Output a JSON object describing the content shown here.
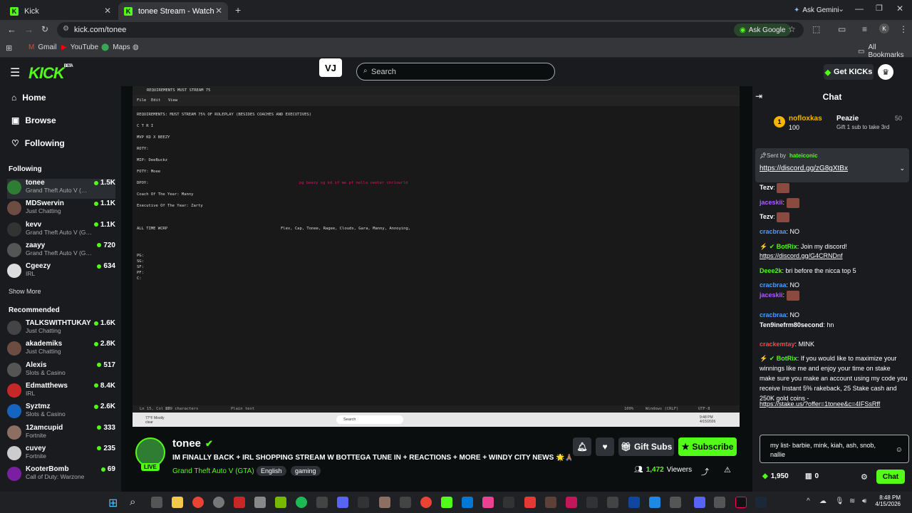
{
  "browser": {
    "tabs": [
      {
        "label": "Kick"
      },
      {
        "label": "tonee Stream - Watch Live on K"
      }
    ],
    "ask_gemini": "Ask Gemini",
    "url": "kick.com/tonee",
    "ask_google": "Ask Google",
    "bookmarks": [
      "Gmail",
      "YouTube",
      "Maps"
    ],
    "all_bookmarks": "All Bookmarks"
  },
  "header": {
    "logo": "KICK",
    "beta": "BETA",
    "search_placeholder": "Search",
    "get_kicks": "Get KICKs"
  },
  "sidebar": {
    "nav": [
      {
        "label": "Home"
      },
      {
        "label": "Browse"
      },
      {
        "label": "Following"
      }
    ],
    "following_title": "Following",
    "following": [
      {
        "name": "tonee",
        "game": "Grand Theft Auto V (…",
        "viewers": "1.5K",
        "color": "#2e7d32"
      },
      {
        "name": "MDSwervin",
        "game": "Just Chatting",
        "viewers": "1.1K",
        "color": "#6d4c41"
      },
      {
        "name": "kevv",
        "game": "Grand Theft Auto V (G…",
        "viewers": "1.1K",
        "color": "#333"
      },
      {
        "name": "zaayy",
        "game": "Grand Theft Auto V (G…",
        "viewers": "720",
        "color": "#555"
      },
      {
        "name": "Cgeezy",
        "game": "IRL",
        "viewers": "634",
        "color": "#ddd"
      }
    ],
    "show_more": "Show More",
    "recommended_title": "Recommended",
    "recommended": [
      {
        "name": "TALKSWITHTUKAY",
        "game": "Just Chatting",
        "viewers": "1.6K",
        "color": "#444"
      },
      {
        "name": "akademiks",
        "game": "Just Chatting",
        "viewers": "2.8K",
        "color": "#6d4c41"
      },
      {
        "name": "Alexis",
        "game": "Slots & Casino",
        "viewers": "517",
        "color": "#555"
      },
      {
        "name": "Edmatthews",
        "game": "IRL",
        "viewers": "8.4K",
        "color": "#c62828"
      },
      {
        "name": "Syztmz",
        "game": "Slots & Casino",
        "viewers": "2.6K",
        "color": "#1565c0"
      },
      {
        "name": "12amcupid",
        "game": "Fortnite",
        "viewers": "333",
        "color": "#8d6e63"
      },
      {
        "name": "cuvey",
        "game": "Fortnite",
        "viewers": "235",
        "color": "#ccc"
      },
      {
        "name": "KooterBomb",
        "game": "Call of Duty: Warzone",
        "viewers": "69",
        "color": "#7b1fa2"
      }
    ]
  },
  "video": {
    "tab_title": "REQUIREMENTS MUST STREAM 75",
    "menu": [
      "File",
      "Edit",
      "View"
    ],
    "lines": [
      "REQUIREMENTS: MUST STREAM 75% OF ROLEPLAY (BESIDES COACHES AND EXECUTIVES)",
      "C T R I",
      "MVP KD X BEEZY",
      "ROTY:",
      "MIP: DeeBuckz",
      "FOTY: Moee",
      "DPOY:",
      "Coach Of The Year: Manny",
      "Executive Of The Year: Zarty",
      "ALL TIME WCRP",
      "PG:",
      "SG:",
      "SF:",
      "PF:",
      "C:"
    ],
    "dpoy_right": "pg beezy sg kd sf me pf nella center chriswrld",
    "alltime_right": "Flex, Cap, Tonee, Ragee, Clouds, Gara, Manny, Annoying,",
    "status": [
      "Ln 15, Col 26",
      "829 characters",
      "Plain text",
      "100%",
      "Windows (CRLF)",
      "UTF-8"
    ],
    "weather": "77°F Mostly clear",
    "task_search": "Search",
    "clock": "9:48 PM 4/15/2026"
  },
  "stream": {
    "name": "tonee",
    "live": "LIVE",
    "title": "IM FINALLY BACK + IRL SHOPPING STREAM W BOTTEGA TUNE IN + REACTIONS + MORE + WINDY CITY NEWS 🌟🙏🏽",
    "category": "Grand Theft Auto V (GTA)",
    "tags": [
      "English",
      "gaming"
    ],
    "gift_subs": "Gift Subs",
    "subscribe": "Subscribe",
    "viewers": "1,472",
    "viewers_label": "Viewers"
  },
  "chat": {
    "title": "Chat",
    "top_gifter": "nofloxkas",
    "top_gifter_amount": "100",
    "peazie": "Peazie",
    "peazie_amount": "50",
    "gift_hint": "Gift 1 sub to take 3rd",
    "pinned_by_label": "Sent by",
    "pinned_by": "hateiconic",
    "pinned_link": "https://discord.gg/zG8gXtBx",
    "messages": [
      {
        "user": "Tezv",
        "text": "",
        "color": "#fff"
      },
      {
        "user": "jaceskii",
        "text": "",
        "color": "#b05bff"
      },
      {
        "user": "Tezv",
        "text": "",
        "color": "#fff"
      },
      {
        "user": "cracbraa",
        "text": "NO",
        "color": "#4a9dff"
      },
      {
        "user": "BotRix",
        "text": "Join my discord!",
        "color": "#53fc18"
      },
      {
        "user": "",
        "text": "https://discord.gg/G4CRNDnf",
        "color": "#fff"
      },
      {
        "user": "Deee2k",
        "text": "bri before the nicca top 5",
        "color": "#53fc18"
      },
      {
        "user": "cracbraa",
        "text": "NO",
        "color": "#4a9dff"
      },
      {
        "user": "jaceskii",
        "text": "",
        "color": "#b05bff"
      },
      {
        "user": "cracbraa",
        "text": "NO",
        "color": "#4a9dff"
      },
      {
        "user": "Ten9inefrm80second",
        "text": "hn",
        "color": "#fff"
      },
      {
        "user": "crackemtay",
        "text": "MINK",
        "color": "#ff4444"
      },
      {
        "user": "BotRix",
        "text": "If you would like to maximize your winnings like me and enjoy your time on stake make sure you make an account using my code you receive Instant 5% rakeback, 25 Stake cash and 250K gold coins -",
        "color": "#53fc18"
      },
      {
        "user": "",
        "text": "https://stake.us/?offer=1tonee&c=4IFSsRff",
        "color": "#fff"
      }
    ],
    "input_text": "my list- barbie, mink, kiah, ash, snob, nallie",
    "points": "1,950",
    "gifts": "0",
    "send": "Chat"
  },
  "taskbar": {
    "time": "8:48 PM",
    "date": "4/15/2026"
  }
}
